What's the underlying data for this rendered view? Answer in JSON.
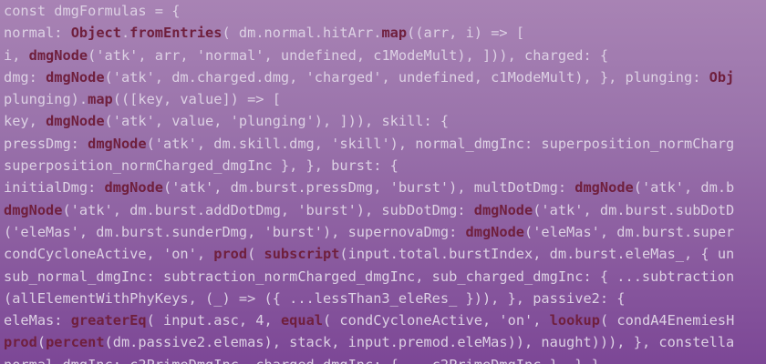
{
  "code_lines": [
    [
      {
        "t": "const dmgFormulas = {",
        "c": "p"
      }
    ],
    [
      {
        "t": "normal: ",
        "c": "p"
      },
      {
        "t": "Object",
        "c": "f"
      },
      {
        "t": ".",
        "c": "p"
      },
      {
        "t": "fromEntries",
        "c": "f"
      },
      {
        "t": "( dm.normal.hitArr.",
        "c": "p"
      },
      {
        "t": "map",
        "c": "f"
      },
      {
        "t": "((arr, i) => [",
        "c": "p"
      }
    ],
    [
      {
        "t": "i, ",
        "c": "p"
      },
      {
        "t": "dmgNode",
        "c": "f"
      },
      {
        "t": "('atk', arr, 'normal', undefined, c1ModeMult), ])), charged: {",
        "c": "p"
      }
    ],
    [
      {
        "t": "dmg: ",
        "c": "p"
      },
      {
        "t": "dmgNode",
        "c": "f"
      },
      {
        "t": "('atk', dm.charged.dmg, 'charged', undefined, c1ModeMult), }, plunging: ",
        "c": "p"
      },
      {
        "t": "Obj",
        "c": "f"
      }
    ],
    [
      {
        "t": "plunging).",
        "c": "p"
      },
      {
        "t": "map",
        "c": "f"
      },
      {
        "t": "(([key, value]) => [",
        "c": "p"
      }
    ],
    [
      {
        "t": "key, ",
        "c": "p"
      },
      {
        "t": "dmgNode",
        "c": "f"
      },
      {
        "t": "('atk', value, 'plunging'), ])), skill: {",
        "c": "p"
      }
    ],
    [
      {
        "t": "pressDmg: ",
        "c": "p"
      },
      {
        "t": "dmgNode",
        "c": "f"
      },
      {
        "t": "('atk', dm.skill.dmg, 'skill'), normal_dmgInc: superposition_normCharg",
        "c": "p"
      }
    ],
    [
      {
        "t": "superposition_normCharged_dmgInc }, }, burst: {",
        "c": "p"
      }
    ],
    [
      {
        "t": "initialDmg: ",
        "c": "p"
      },
      {
        "t": "dmgNode",
        "c": "f"
      },
      {
        "t": "('atk', dm.burst.pressDmg, 'burst'), multDotDmg: ",
        "c": "p"
      },
      {
        "t": "dmgNode",
        "c": "f"
      },
      {
        "t": "('atk', dm.b",
        "c": "p"
      }
    ],
    [
      {
        "t": "dmgNode",
        "c": "f"
      },
      {
        "t": "('atk', dm.burst.addDotDmg, 'burst'), subDotDmg: ",
        "c": "p"
      },
      {
        "t": "dmgNode",
        "c": "f"
      },
      {
        "t": "('atk', dm.burst.subDotD",
        "c": "p"
      }
    ],
    [
      {
        "t": "('eleMas', dm.burst.sunderDmg, 'burst'), supernovaDmg: ",
        "c": "p"
      },
      {
        "t": "dmgNode",
        "c": "f"
      },
      {
        "t": "('eleMas', dm.burst.super",
        "c": "p"
      }
    ],
    [
      {
        "t": "condCycloneActive, 'on', ",
        "c": "p"
      },
      {
        "t": "prod",
        "c": "f"
      },
      {
        "t": "( ",
        "c": "p"
      },
      {
        "t": "subscript",
        "c": "f"
      },
      {
        "t": "(input.total.burstIndex, dm.burst.eleMas_, { un",
        "c": "p"
      }
    ],
    [
      {
        "t": "sub_normal_dmgInc: subtraction_normCharged_dmgInc, sub_charged_dmgInc: { ...subtraction",
        "c": "p"
      }
    ],
    [
      {
        "t": "(allElementWithPhyKeys, (_) => ({ ...lessThan3_eleRes_ })), }, passive2: {",
        "c": "p"
      }
    ],
    [
      {
        "t": "eleMas: ",
        "c": "p"
      },
      {
        "t": "greaterEq",
        "c": "f"
      },
      {
        "t": "( input.asc, 4, ",
        "c": "p"
      },
      {
        "t": "equal",
        "c": "f"
      },
      {
        "t": "( condCycloneActive, 'on', ",
        "c": "p"
      },
      {
        "t": "lookup",
        "c": "f"
      },
      {
        "t": "( condA4EnemiesH",
        "c": "p"
      }
    ],
    [
      {
        "t": "prod",
        "c": "f"
      },
      {
        "t": "(",
        "c": "p"
      },
      {
        "t": "percent",
        "c": "f"
      },
      {
        "t": "(dm.passive2.elemas), stack, input.premod.eleMas)), naught))), }, constella",
        "c": "p"
      }
    ],
    [
      {
        "t": "normal_dmgInc: c2PrimeDmgInc, charged_dmgInc: { ...c2PrimeDmgInc }, },}",
        "c": "p"
      }
    ]
  ],
  "colors": {
    "plain": "#ddd1e4",
    "function": "#6f1f3d",
    "bg_top": "#a883b4",
    "bg_bottom": "#7c4796"
  }
}
